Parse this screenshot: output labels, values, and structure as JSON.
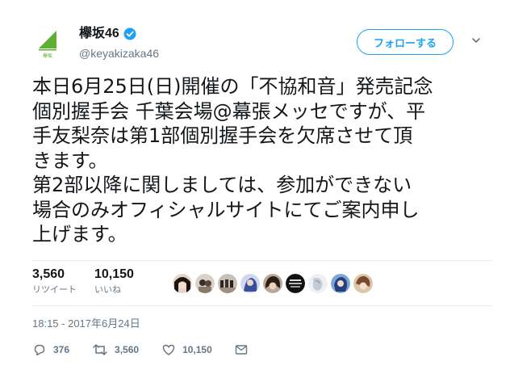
{
  "account": {
    "display_name": "欅坂46",
    "handle": "@keyakizaka46",
    "logo_icon": "keyakizaka-logo-icon",
    "logo_text": "欅坂",
    "verified_icon": "verified-badge-icon"
  },
  "follow_button": {
    "label": "フォローする"
  },
  "tweet": {
    "lines": [
      "本日6月25日(日)開催の「不協和音」発売記念",
      "個別握手会 千葉会場@幕張メッセですが、平",
      "手友梨奈は第1部個別握手会を欠席させて頂",
      "きます。",
      "第2部以降に関しましては、参加ができない",
      "場合のみオフィシャルサイトにてご案内申し",
      "上げます。"
    ]
  },
  "stats": {
    "retweets": {
      "count": "3,560",
      "label": "リツイート"
    },
    "likes": {
      "count": "10,150",
      "label": "いいね"
    },
    "avatar_count": 9
  },
  "timestamp": "18:15 - 2017年6月24日",
  "actions": {
    "reply": {
      "icon": "reply-icon",
      "count": "376"
    },
    "retweet": {
      "icon": "retweet-icon",
      "count": "3,560"
    },
    "like": {
      "icon": "heart-icon",
      "count": "10,150"
    },
    "dm": {
      "icon": "envelope-icon"
    }
  },
  "colors": {
    "accent": "#1da1f2",
    "text": "#14171a",
    "muted": "#657786",
    "logo_green": "#5fb030"
  }
}
